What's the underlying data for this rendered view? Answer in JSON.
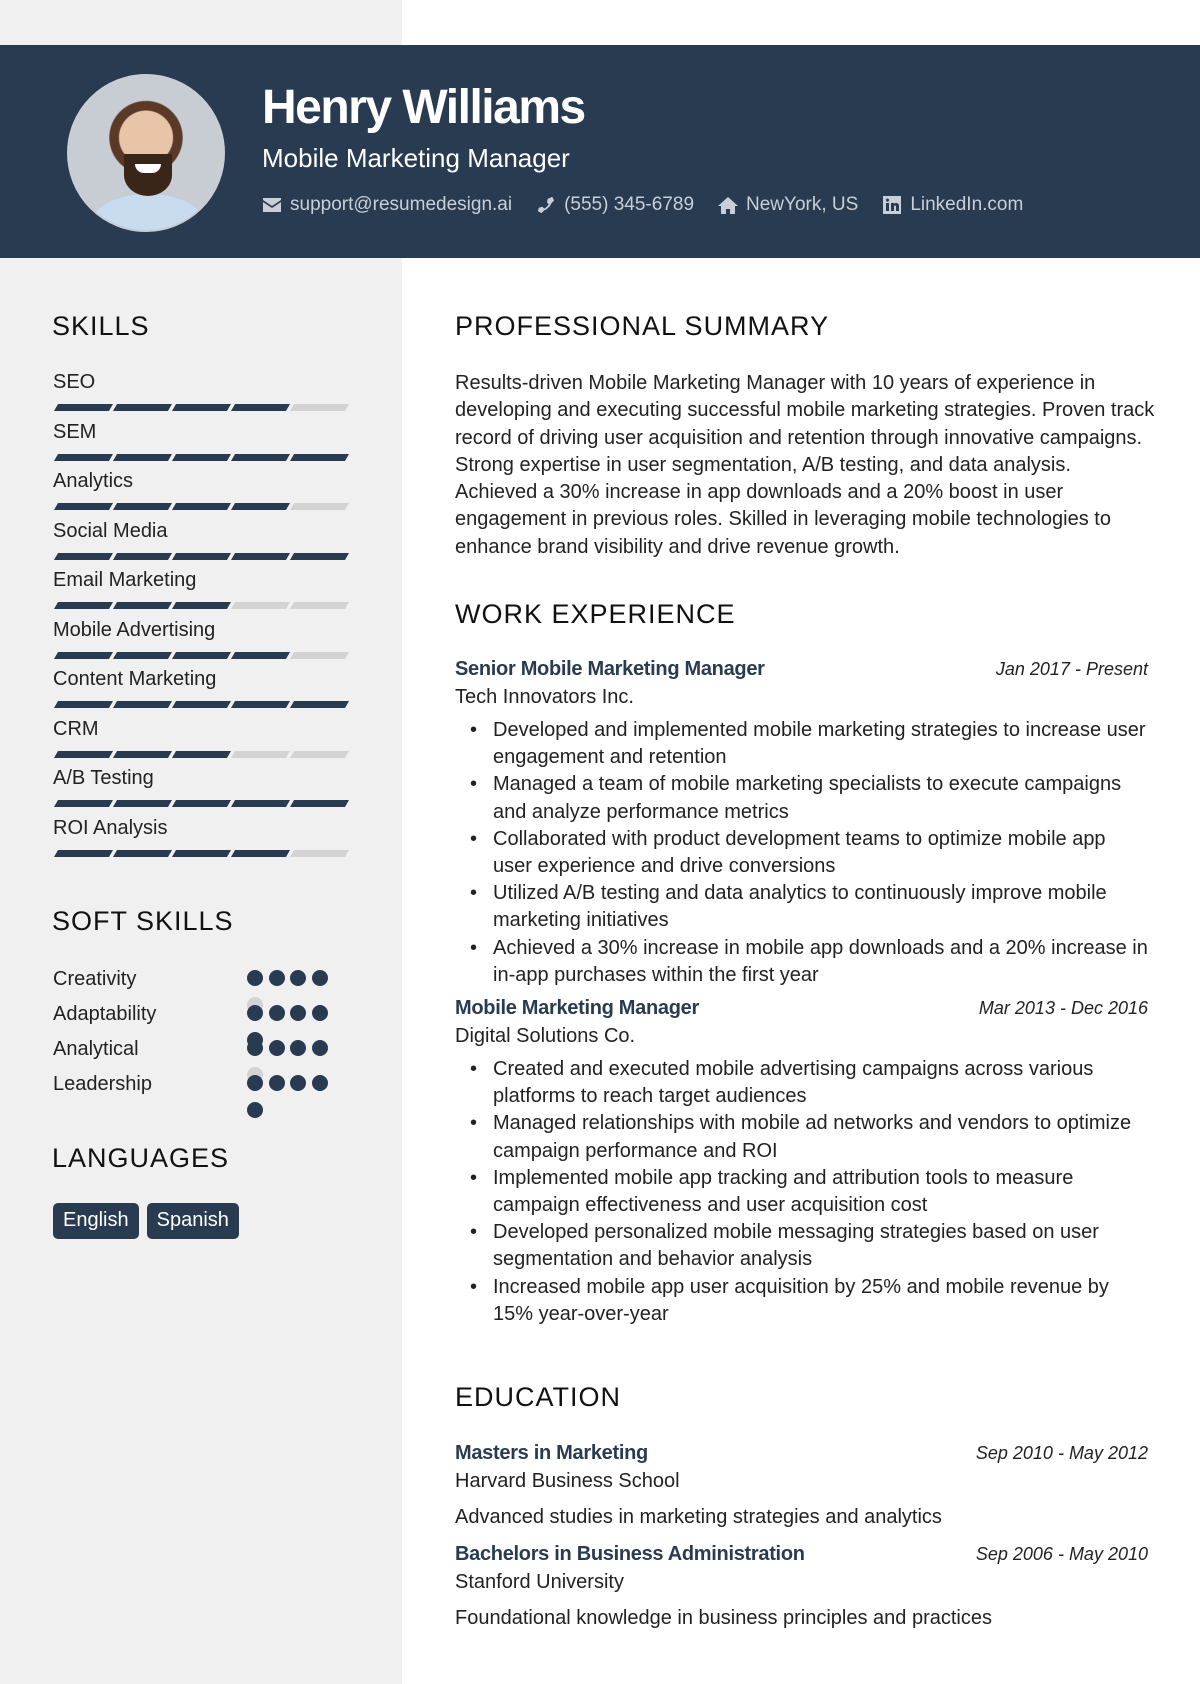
{
  "header": {
    "name": "Henry Williams",
    "title": "Mobile Marketing Manager",
    "contacts": [
      {
        "icon": "envelope-icon",
        "text": "support@resumedesign.ai"
      },
      {
        "icon": "phone-icon",
        "text": "(555) 345-6789"
      },
      {
        "icon": "home-icon",
        "text": "NewYork, US"
      },
      {
        "icon": "linkedin-icon",
        "text": "LinkedIn.com"
      }
    ]
  },
  "colors": {
    "accent": "#283b51",
    "sidebar": "#f0f0f0",
    "inactive": "#d3d3d3"
  },
  "sidebar": {
    "skills_heading": "SKILLS",
    "skills_max": 5,
    "skills": [
      {
        "name": "SEO",
        "level": 4
      },
      {
        "name": "SEM",
        "level": 5
      },
      {
        "name": "Analytics",
        "level": 4
      },
      {
        "name": "Social Media",
        "level": 5
      },
      {
        "name": "Email Marketing",
        "level": 3
      },
      {
        "name": "Mobile Advertising",
        "level": 4
      },
      {
        "name": "Content Marketing",
        "level": 5
      },
      {
        "name": "CRM",
        "level": 3
      },
      {
        "name": "A/B Testing",
        "level": 5
      },
      {
        "name": "ROI Analysis",
        "level": 4
      }
    ],
    "soft_skills_heading": "SOFT SKILLS",
    "soft_skills_max": 5,
    "soft_skills": [
      {
        "name": "Creativity",
        "level": 4
      },
      {
        "name": "Adaptability",
        "level": 5
      },
      {
        "name": "Analytical",
        "level": 4
      },
      {
        "name": "Leadership",
        "level": 5
      }
    ],
    "languages_heading": "LANGUAGES",
    "languages": [
      "English",
      "Spanish"
    ]
  },
  "main": {
    "summary_heading": "PROFESSIONAL SUMMARY",
    "summary": "Results-driven Mobile Marketing Manager with 10 years of experience in developing and executing successful mobile marketing strategies. Proven track record of driving user acquisition and retention through innovative campaigns. Strong expertise in user segmentation, A/B testing, and data analysis. Achieved a 30% increase in app downloads and a 20% boost in user engagement in previous roles. Skilled in leveraging mobile technologies to enhance brand visibility and drive revenue growth.",
    "work_heading": "WORK EXPERIENCE",
    "jobs": [
      {
        "title": "Senior Mobile Marketing Manager",
        "company": "Tech Innovators Inc.",
        "dates": "Jan 2017 - Present",
        "bullets": [
          "Developed and implemented mobile marketing strategies to increase user engagement and retention",
          "Managed a team of mobile marketing specialists to execute campaigns and analyze performance metrics",
          "Collaborated with product development teams to optimize mobile app user experience and drive conversions",
          "Utilized A/B testing and data analytics to continuously improve mobile marketing initiatives",
          "Achieved a 30% increase in mobile app downloads and a 20% increase in in-app purchases within the first year"
        ]
      },
      {
        "title": "Mobile Marketing Manager",
        "company": "Digital Solutions Co.",
        "dates": "Mar 2013 - Dec 2016",
        "bullets": [
          "Created and executed mobile advertising campaigns across various platforms to reach target audiences",
          "Managed relationships with mobile ad networks and vendors to optimize campaign performance and ROI",
          "Implemented mobile app tracking and attribution tools to measure campaign effectiveness and user acquisition cost",
          "Developed personalized mobile messaging strategies based on user segmentation and behavior analysis",
          "Increased mobile app user acquisition by 25% and mobile revenue by 15% year-over-year"
        ]
      }
    ],
    "education_heading": "EDUCATION",
    "education": [
      {
        "degree": "Masters in Marketing",
        "school": "Harvard Business School",
        "dates": "Sep 2010 - May 2012",
        "description": "Advanced studies in marketing strategies and analytics"
      },
      {
        "degree": "Bachelors in Business Administration",
        "school": "Stanford University",
        "dates": "Sep 2006 - May 2010",
        "description": "Foundational knowledge in business principles and practices"
      }
    ]
  }
}
